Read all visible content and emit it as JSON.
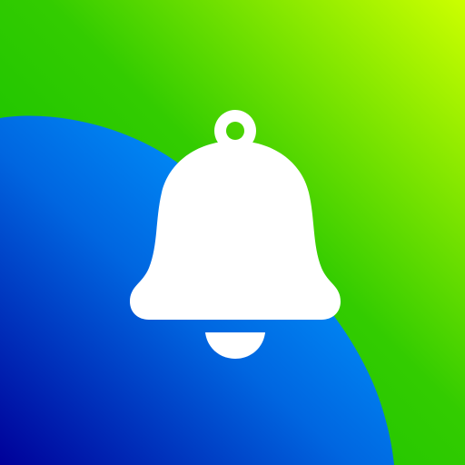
{
  "icon": {
    "name": "bell-icon",
    "colors": {
      "green_gradient_top_right": "#CCFF00",
      "green_gradient_mid": "#33CC00",
      "green_gradient_bottom_left": "#00BB00",
      "blue_gradient_light": "#0099FF",
      "blue_gradient_mid": "#0066E0",
      "blue_gradient_dark": "#000099",
      "bell_fill": "#FFFFFF"
    }
  }
}
